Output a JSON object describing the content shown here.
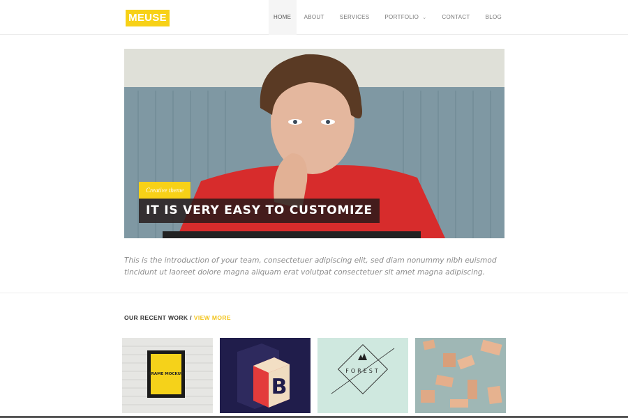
{
  "header": {
    "logo": "MEUSE",
    "nav": [
      {
        "label": "HOME",
        "active": true
      },
      {
        "label": "ABOUT"
      },
      {
        "label": "SERVICES"
      },
      {
        "label": "PORTFOLIO",
        "has_dropdown": true
      },
      {
        "label": "CONTACT"
      },
      {
        "label": "BLOG"
      }
    ],
    "dropdown_icon": "chevron-down-icon"
  },
  "hero": {
    "tag": "Creative theme",
    "title": "IT IS VERY EASY TO CUSTOMIZE"
  },
  "intro": {
    "text": "This is the introduction of your team, consectetuer adipiscing elit, sed diam nonummy nibh euismod tincidunt ut laoreet dolore magna aliquam erat volutpat consectetuer sit amet magna adipiscing."
  },
  "recent_work": {
    "heading": "OUR RECENT WORK /",
    "view_more": "VIEW MORE",
    "items": [
      {
        "name": "frame-mockup",
        "caption": "FRAME MOCKUP"
      },
      {
        "name": "letter-b-3d"
      },
      {
        "name": "forest-badge",
        "caption": "FOREST"
      },
      {
        "name": "wooden-blocks"
      }
    ]
  },
  "colors": {
    "accent": "#f7d117",
    "text_muted": "#8c8c8c",
    "hero_title_bg": "#231919"
  }
}
